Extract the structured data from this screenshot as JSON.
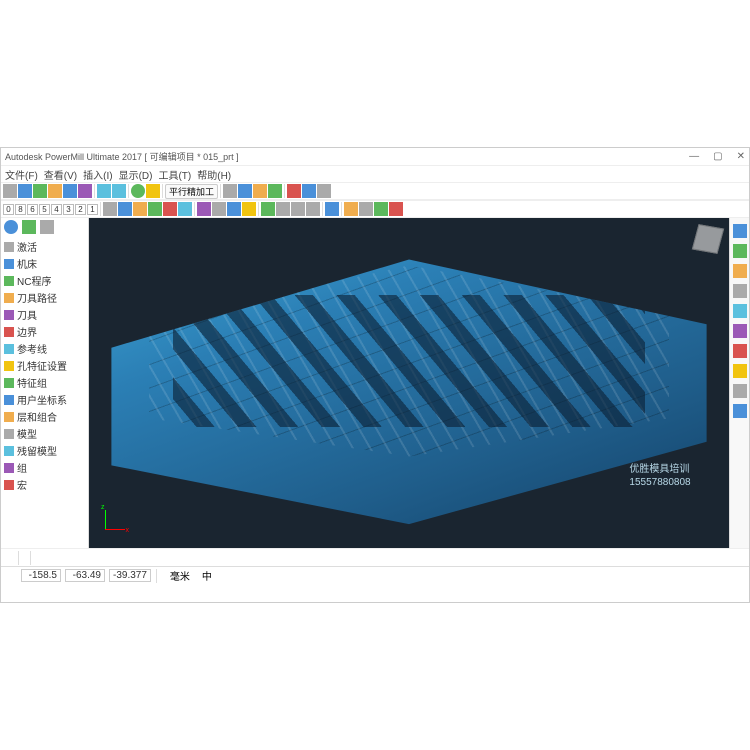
{
  "title": "Autodesk PowerMill Ultimate 2017    [ 可编辑项目 * 015_prt ]",
  "menu": {
    "file": "文件(F)",
    "view": "查看(V)",
    "insert": "插入(I)",
    "display": "显示(D)",
    "tool": "工具(T)",
    "help": "帮助(H)"
  },
  "toolbar2": {
    "btn_label": "平行精加工"
  },
  "numbers": [
    "0",
    "8",
    "6",
    "5",
    "4",
    "3",
    "2",
    "1"
  ],
  "tree": {
    "items": [
      "激活",
      "机床",
      "NC程序",
      "刀具路径",
      "刀具",
      "边界",
      "参考线",
      "孔特征设置",
      "特征组",
      "用户坐标系",
      "层和组合",
      "模型",
      "残留模型",
      "组",
      "宏"
    ]
  },
  "axis": {
    "x": "x",
    "z": "z"
  },
  "watermark": {
    "line1": "优胜模具培训",
    "line2": "15557880808"
  },
  "status": {
    "x": "-158.5",
    "y": "-63.49",
    "z": "-39.377",
    "unit": "毫米",
    "mid": "中"
  }
}
